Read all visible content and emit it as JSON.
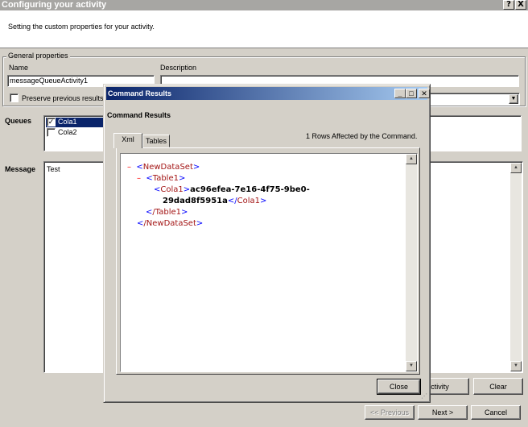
{
  "outer": {
    "title": "Configuring your activity",
    "help_btn": "?",
    "close_btn": "X",
    "subtitle": "Setting the custom properties for your activity.",
    "general_legend": "General properties",
    "name_label": "Name",
    "name_value": "messageQueueActivity1",
    "description_label": "Description",
    "description_value": "",
    "preserve_label": "Preserve previous results",
    "queues_label": "Queues",
    "queues": [
      {
        "label": "Cola1",
        "checked": true
      },
      {
        "label": "Cola2",
        "checked": false
      }
    ],
    "message_label": "Message",
    "message_value": "Test",
    "activity_btn": "ctivity",
    "clear_btn": "Clear",
    "prev_btn": "<< Previous",
    "next_btn": "Next >",
    "cancel_btn": "Cancel"
  },
  "dialog": {
    "title": "Command Results",
    "heading": "Command Results",
    "tabs": [
      {
        "label": "Xml",
        "active": true
      },
      {
        "label": "Tables",
        "active": false
      }
    ],
    "rows_affected": "1  Rows Affected by the Command.",
    "xml": {
      "minus": "–",
      "root_open": "NewDataSet",
      "table_open": "Table1",
      "col_tag": "Cola1",
      "col_value_line1": "ac96efea-7e16-4f75-9be0-",
      "col_value_line2": "29dad8f5951a",
      "table_close": "/Table1",
      "root_close": "/NewDataSet"
    },
    "close_btn": "Close"
  }
}
